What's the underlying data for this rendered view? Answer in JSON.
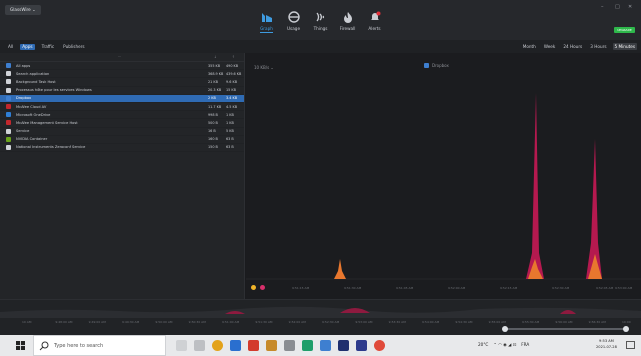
{
  "app": {
    "menu_label": "GlassWire ⌄"
  },
  "nav": [
    {
      "label": "Graph",
      "icon": "graph-icon",
      "active": true
    },
    {
      "label": "Usage",
      "icon": "usage-icon",
      "active": false
    },
    {
      "label": "Things",
      "icon": "things-icon",
      "active": false
    },
    {
      "label": "Firewall",
      "icon": "firewall-icon",
      "active": false
    },
    {
      "label": "Alerts",
      "icon": "alerts-icon",
      "active": false
    }
  ],
  "window_controls": {
    "minimize": "–",
    "maximize": "□",
    "close": "✕"
  },
  "status_badge": "UPGRADE",
  "filter_tabs": [
    "All",
    "Apps",
    "Traffic",
    "Publishers"
  ],
  "filter_active": "Apps",
  "time_tabs": [
    "Month",
    "Week",
    "24 Hours",
    "3 Hours",
    "5 Minutes"
  ],
  "time_active": "5 Minutes",
  "list": {
    "header_mid": "···",
    "header_c1": "↓",
    "header_c2": "↑",
    "rows": [
      {
        "name": "All apps",
        "c1": "355 KB",
        "c2": "490 KB",
        "color": "#3e7fd0",
        "selected": false
      },
      {
        "name": "Search application",
        "c1": "368.9 KB",
        "c2": "439.6 KB",
        "color": "#d0d3d8",
        "selected": false
      },
      {
        "name": "Background Task Host",
        "c1": "21 KB",
        "c2": "9.6 KB",
        "color": "#d0d3d8",
        "selected": false
      },
      {
        "name": "Processus hôte pour les services Windows",
        "c1": "20.3 KB",
        "c2": "15 KB",
        "color": "#d0d3d8",
        "selected": false
      },
      {
        "name": "Dropbox",
        "c1": "2 KB",
        "c2": "3.4 KB",
        "color": "#3e7fd0",
        "selected": true
      },
      {
        "name": "McAfee Cloud AV",
        "c1": "11.7 KB",
        "c2": "4.5 KB",
        "color": "#c2272d",
        "selected": false
      },
      {
        "name": "Microsoft OneDrive",
        "c1": "998 B",
        "c2": "1 KB",
        "color": "#2f7fd6",
        "selected": false
      },
      {
        "name": "McAfee Management Service Host",
        "c1": "500 B",
        "c2": "1 KB",
        "color": "#c2272d",
        "selected": false
      },
      {
        "name": "Service",
        "c1": "16 B",
        "c2": "5 KB",
        "color": "#d0d3d8",
        "selected": false
      },
      {
        "name": "NVIDIA Container",
        "c1": "160 B",
        "c2": "63 B",
        "color": "#6aa41b",
        "selected": false
      },
      {
        "name": "National Instruments Zeroconf Service",
        "c1": "150 B",
        "c2": "63 B",
        "color": "#d0d3d8",
        "selected": false
      }
    ]
  },
  "graph": {
    "scale_label": "10 KB/s ⌄",
    "legend_label": "Dropbox",
    "x_labels": [
      "9:51:15 AM",
      "9:51:30 AM",
      "9:51:45 AM",
      "9:52:00 AM",
      "9:52:15 AM",
      "9:52:30 AM",
      "9:52:45 AM",
      "9:53:00 AM"
    ],
    "incoming_color": "#e8772e",
    "outgoing_color": "#b5194f"
  },
  "overview": {
    "x_labels": [
      "10 AM",
      "9:48:00 AM",
      "9:49:00 AM",
      "9:49:30 AM",
      "9:50:00 AM",
      "9:50:30 AM",
      "9:51:00 AM",
      "9:51:30 AM",
      "9:52:00 AM",
      "9:52:30 AM",
      "9:53:00 AM",
      "9:53:30 AM",
      "9:54:00 AM",
      "9:54:30 AM",
      "9:55:00 AM",
      "9:55:30 AM",
      "9:56:00 AM",
      "9:56:30 AM",
      "10:00"
    ]
  },
  "taskbar": {
    "search_placeholder": "Type here to search",
    "tray_text": "20°C",
    "lang": "FRA",
    "time": "9:53 AM",
    "date": "2021-07-28"
  }
}
